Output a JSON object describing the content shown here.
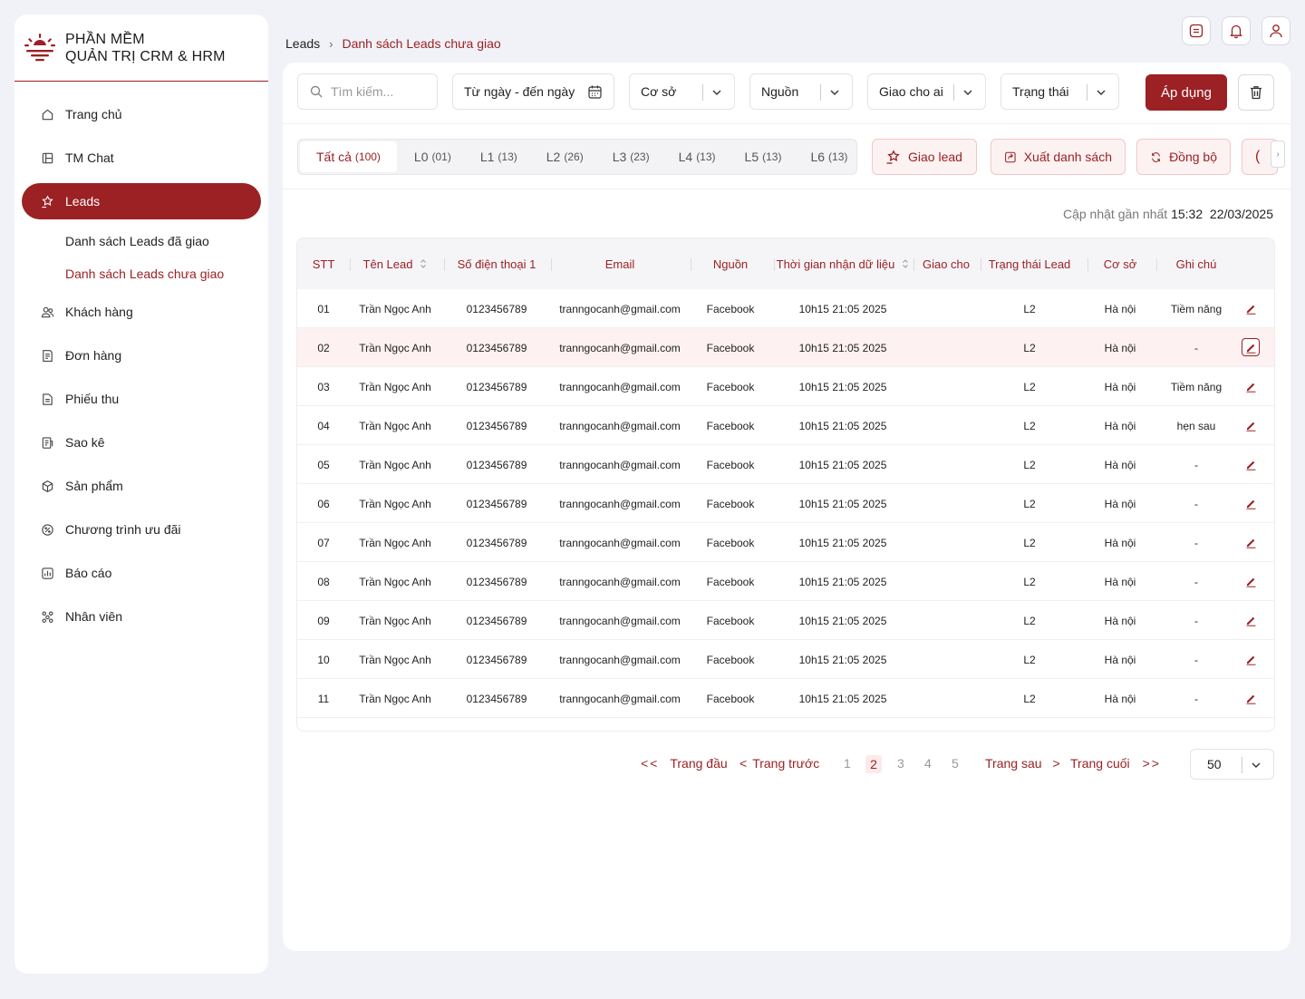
{
  "brand": {
    "line1": "PHẦN MỀM",
    "line2": "QUẢN TRỊ CRM & HRM"
  },
  "sidebar": {
    "items": [
      {
        "label": "Trang chủ",
        "icon": "home-icon"
      },
      {
        "label": "TM Chat",
        "icon": "chat-icon"
      },
      {
        "label": "Leads",
        "icon": "star-hand-icon",
        "active": true
      },
      {
        "label": "Khách hàng",
        "icon": "users-icon"
      },
      {
        "label": "Đơn hàng",
        "icon": "order-icon"
      },
      {
        "label": "Phiếu thu",
        "icon": "receipt-icon"
      },
      {
        "label": "Sao kê",
        "icon": "statement-icon"
      },
      {
        "label": "Sản phẩm",
        "icon": "box-icon"
      },
      {
        "label": "Chương trình ưu đãi",
        "icon": "discount-icon"
      },
      {
        "label": "Báo cáo",
        "icon": "report-icon"
      },
      {
        "label": "Nhân viên",
        "icon": "staff-icon"
      }
    ],
    "sub_items": [
      {
        "label": "Danh sách Leads đã giao"
      },
      {
        "label": "Danh sách Leads chưa giao",
        "current": true
      }
    ]
  },
  "breadcrumb": {
    "root": "Leads",
    "current": "Danh sách Leads chưa giao"
  },
  "filters": {
    "search_placeholder": "Tìm kiếm...",
    "date_range": "Từ ngày - đến ngày",
    "co_so": "Cơ sở",
    "nguon": "Nguồn",
    "giao_cho": "Giao cho ai",
    "trang_thai": "Trạng thái",
    "apply": "Áp dụng"
  },
  "tabs": [
    {
      "label": "Tất cả",
      "count": "(100)",
      "active": true
    },
    {
      "label": "L0",
      "count": "(01)"
    },
    {
      "label": "L1",
      "count": "(13)"
    },
    {
      "label": "L2",
      "count": "(26)"
    },
    {
      "label": "L3",
      "count": "(23)"
    },
    {
      "label": "L4",
      "count": "(13)"
    },
    {
      "label": "L5",
      "count": "(13)"
    },
    {
      "label": "L6",
      "count": "(13)"
    }
  ],
  "actions": {
    "giao_lead": "Giao lead",
    "xuat": "Xuất danh sách",
    "dong_bo": "Đồng bộ"
  },
  "updated": {
    "label": "Cập nhật gần nhất",
    "time": "15:32",
    "date": "22/03/2025"
  },
  "table": {
    "headers": [
      "STT",
      "Tên Lead",
      "Số điện thoại 1",
      "Email",
      "Nguồn",
      "Thời gian nhận dữ liệu",
      "Giao cho",
      "Trạng thái Lead",
      "Cơ sở",
      "Ghi chú"
    ],
    "rows": [
      {
        "stt": "01",
        "name": "Trần Ngọc Anh",
        "phone": "0123456789",
        "email": "tranngocanh@gmail.com",
        "source": "Facebook",
        "time": "10h15 21:05  2025",
        "assignee": "",
        "status": "L2",
        "branch": "Hà nội",
        "note": "Tiềm năng"
      },
      {
        "stt": "02",
        "name": "Trần Ngọc Anh",
        "phone": "0123456789",
        "email": "tranngocanh@gmail.com",
        "source": "Facebook",
        "time": "10h15 21:05  2025",
        "assignee": "",
        "status": "L2",
        "branch": "Hà nội",
        "note": "-",
        "highlight": true
      },
      {
        "stt": "03",
        "name": "Trần Ngọc Anh",
        "phone": "0123456789",
        "email": "tranngocanh@gmail.com",
        "source": "Facebook",
        "time": "10h15 21:05  2025",
        "assignee": "",
        "status": "L2",
        "branch": "Hà nội",
        "note": "Tiềm năng"
      },
      {
        "stt": "04",
        "name": "Trần Ngọc Anh",
        "phone": "0123456789",
        "email": "tranngocanh@gmail.com",
        "source": "Facebook",
        "time": "10h15 21:05  2025",
        "assignee": "",
        "status": "L2",
        "branch": "Hà nội",
        "note": "hẹn sau"
      },
      {
        "stt": "05",
        "name": "Trần Ngọc Anh",
        "phone": "0123456789",
        "email": "tranngocanh@gmail.com",
        "source": "Facebook",
        "time": "10h15 21:05  2025",
        "assignee": "",
        "status": "L2",
        "branch": "Hà nội",
        "note": "-"
      },
      {
        "stt": "06",
        "name": "Trần Ngọc Anh",
        "phone": "0123456789",
        "email": "tranngocanh@gmail.com",
        "source": "Facebook",
        "time": "10h15 21:05  2025",
        "assignee": "",
        "status": "L2",
        "branch": "Hà nội",
        "note": "-"
      },
      {
        "stt": "07",
        "name": "Trần Ngọc Anh",
        "phone": "0123456789",
        "email": "tranngocanh@gmail.com",
        "source": "Facebook",
        "time": "10h15 21:05  2025",
        "assignee": "",
        "status": "L2",
        "branch": "Hà nội",
        "note": "-"
      },
      {
        "stt": "08",
        "name": "Trần Ngọc Anh",
        "phone": "0123456789",
        "email": "tranngocanh@gmail.com",
        "source": "Facebook",
        "time": "10h15 21:05  2025",
        "assignee": "",
        "status": "L2",
        "branch": "Hà nội",
        "note": "-"
      },
      {
        "stt": "09",
        "name": "Trần Ngọc Anh",
        "phone": "0123456789",
        "email": "tranngocanh@gmail.com",
        "source": "Facebook",
        "time": "10h15 21:05  2025",
        "assignee": "",
        "status": "L2",
        "branch": "Hà nội",
        "note": "-"
      },
      {
        "stt": "10",
        "name": "Trần Ngọc Anh",
        "phone": "0123456789",
        "email": "tranngocanh@gmail.com",
        "source": "Facebook",
        "time": "10h15 21:05  2025",
        "assignee": "",
        "status": "L2",
        "branch": "Hà nội",
        "note": "-"
      },
      {
        "stt": "11",
        "name": "Trần Ngọc Anh",
        "phone": "0123456789",
        "email": "tranngocanh@gmail.com",
        "source": "Facebook",
        "time": "10h15 21:05  2025",
        "assignee": "",
        "status": "L2",
        "branch": "Hà nội",
        "note": "-"
      }
    ]
  },
  "pagination": {
    "first": "Trang đầu",
    "prev": "Trang trước",
    "pages": [
      "1",
      "2",
      "3",
      "4",
      "5"
    ],
    "current": "2",
    "next": "Trang sau",
    "last": "Trang cuối",
    "per_page": "50"
  },
  "colors": {
    "accent": "#9b2124",
    "background": "#f1f2f7"
  }
}
